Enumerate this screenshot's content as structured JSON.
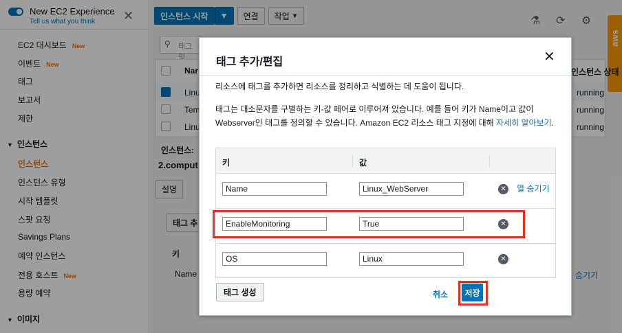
{
  "sidebar": {
    "title": "New EC2 Experience",
    "subtitle": "Tell us what you think",
    "new_badge": "New",
    "items": [
      {
        "label": "EC2 대시보드",
        "new": true
      },
      {
        "label": "이벤트",
        "new": true
      },
      {
        "label": "태그",
        "new": false
      },
      {
        "label": "보고서",
        "new": false
      },
      {
        "label": "제한",
        "new": false
      }
    ],
    "section_instances": "인스턴스",
    "instance_items": [
      {
        "label": "인스턴스",
        "new": false,
        "active": true
      },
      {
        "label": "인스턴스 유형",
        "new": false
      },
      {
        "label": "시작 템플릿",
        "new": false
      },
      {
        "label": "스팟 요청",
        "new": false
      },
      {
        "label": "Savings Plans",
        "new": false
      },
      {
        "label": "예약 인스턴스",
        "new": false
      },
      {
        "label": "전용 호스트",
        "new": true
      },
      {
        "label": "용량 예약",
        "new": false
      }
    ],
    "section_images": "이미지"
  },
  "toolbar": {
    "launch_label": "인스턴스 시작",
    "connect_label": "연결",
    "actions_label": "작업"
  },
  "background": {
    "search_placeholder": "태그 및",
    "col_name": "Nar",
    "col_state": "인스턴스 상태",
    "rows": [
      {
        "name": "Linu",
        "state": "running"
      },
      {
        "name": "Tem",
        "state": "running"
      },
      {
        "name": "Linu",
        "state": "running"
      }
    ],
    "instances_label": "인스턴스:",
    "compute_label": "2.comput",
    "tab_description": "설명",
    "add_tag_btn": "태그 추",
    "key_header": "키",
    "name_cell": "Name",
    "hide_link": "숨기기"
  },
  "modal": {
    "title": "태그 추가/편집",
    "desc1": "리소스에 태그를 추가하면 리소스를 정리하고 식별하는 데 도움이 됩니다.",
    "desc2_text": "태그는 대소문자를 구별하는 키-값 페어로 이루어져 있습니다. 예를 들어 키가 Name이고 값이 Webserver인 태그를 정의할 수 있습니다. Amazon EC2 리소스 태그 지정에 대해 ",
    "desc2_link": "자세히 알아보기",
    "desc2_end": ".",
    "key_header": "키",
    "value_header": "값",
    "tags": [
      {
        "key": "Name",
        "value": "Linux_WebServer"
      },
      {
        "key": "EnableMonitoring",
        "value": "True"
      },
      {
        "key": "OS",
        "value": "Linux"
      }
    ],
    "hide_column": "열 숨기기",
    "create_tag_btn": "태그 생성",
    "cancel_btn": "취소",
    "save_btn": "저장"
  },
  "aws_label": "aws"
}
